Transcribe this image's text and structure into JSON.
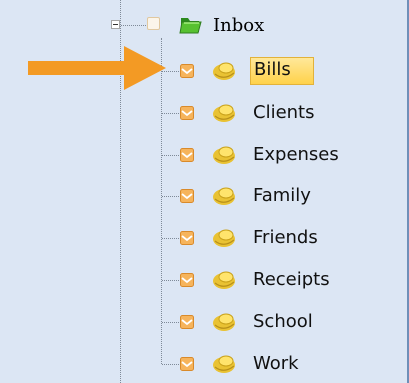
{
  "tree": {
    "root": {
      "label": "Inbox",
      "icon": "green-folder-icon",
      "expander": "minus-expander-icon"
    },
    "folders": [
      {
        "label": "Bills",
        "selected": true
      },
      {
        "label": "Clients",
        "selected": false
      },
      {
        "label": "Expenses",
        "selected": false
      },
      {
        "label": "Family",
        "selected": false
      },
      {
        "label": "Friends",
        "selected": false
      },
      {
        "label": "Receipts",
        "selected": false
      },
      {
        "label": "School",
        "selected": false
      },
      {
        "label": "Work",
        "selected": false
      }
    ]
  },
  "annotation": {
    "icon": "orange-arrow-icon",
    "color": "#f39a24"
  },
  "colors": {
    "panel": "#dce6f4",
    "selection": "#ffd24a",
    "checkbox": "#f0a040"
  }
}
